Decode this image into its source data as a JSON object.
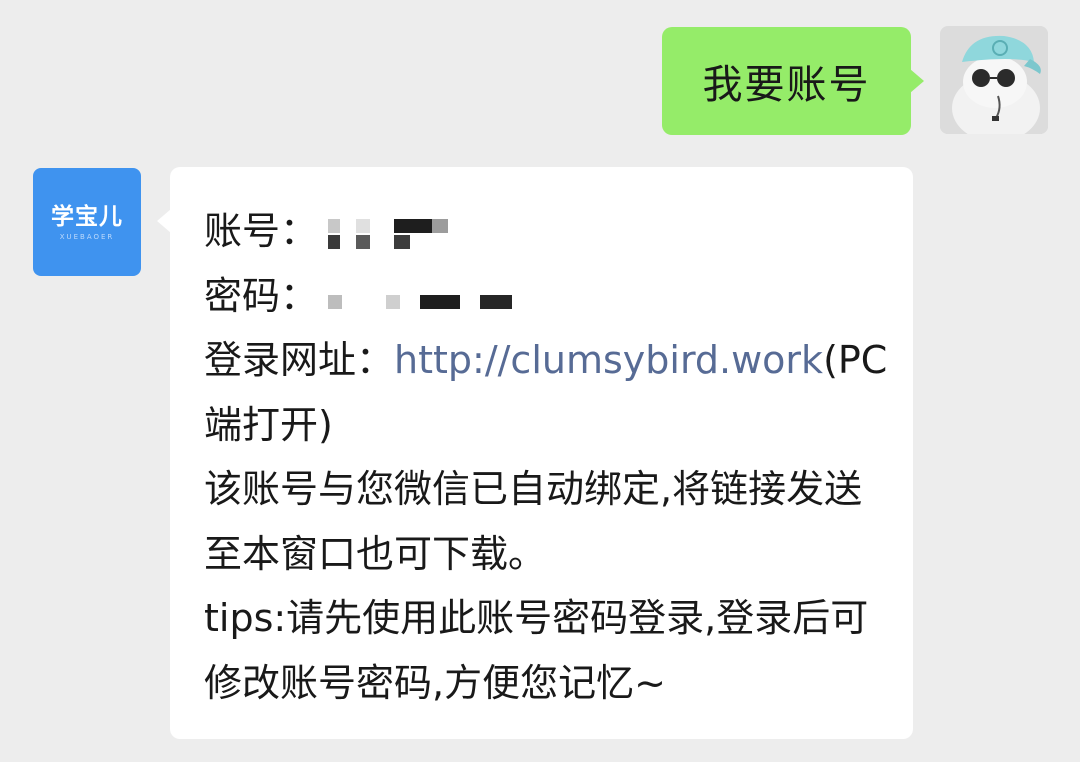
{
  "messages": {
    "outgoing": {
      "text": "我要账号",
      "bubble_color": "#95ec69"
    },
    "incoming": {
      "sender_logo": {
        "main": "学宝儿",
        "sub": "XUEBAOER",
        "color": "#3f93ef"
      },
      "lines": {
        "account_label": "账号：",
        "password_label": "密码：",
        "url_label": "登录网址：",
        "url_link": "http://clumsybird.work",
        "url_note": "(PC 端打开)",
        "bind_notice": "该账号与您微信已自动绑定,将链接发送至本窗口也可下载。",
        "tips": "tips:请先使用此账号密码登录,登录后可修改账号密码,方便您记忆~"
      },
      "link_color": "#576b95"
    }
  },
  "background_color": "#ededed"
}
